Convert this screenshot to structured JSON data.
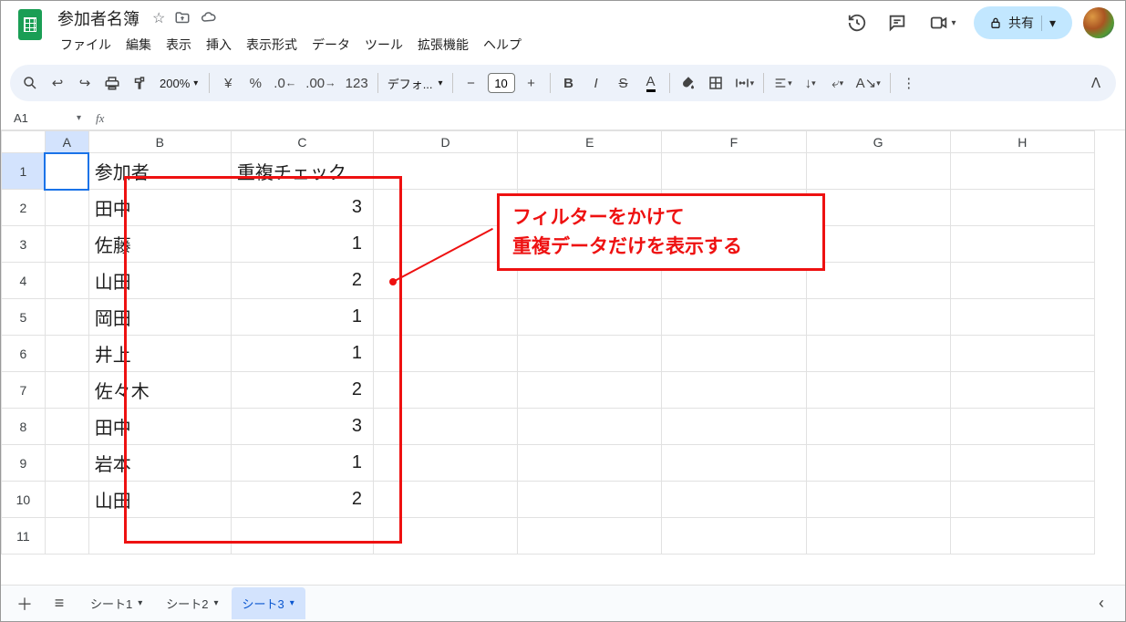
{
  "header": {
    "doc_title": "参加者名簿",
    "menus": [
      "ファイル",
      "編集",
      "表示",
      "挿入",
      "表示形式",
      "データ",
      "ツール",
      "拡張機能",
      "ヘルプ"
    ]
  },
  "share": {
    "label": "共有"
  },
  "toolbar": {
    "zoom": "200%",
    "font": "デフォ...",
    "font_size": "10"
  },
  "namebox": {
    "ref": "A1",
    "formula": ""
  },
  "columns": [
    "A",
    "B",
    "C",
    "D",
    "E",
    "F",
    "G",
    "H"
  ],
  "rows": [
    {
      "n": "1",
      "B": "参加者",
      "C": "重複チェック",
      "c_num": false
    },
    {
      "n": "2",
      "B": "田中",
      "C": "3"
    },
    {
      "n": "3",
      "B": "佐藤",
      "C": "1"
    },
    {
      "n": "4",
      "B": "山田",
      "C": "2"
    },
    {
      "n": "5",
      "B": "岡田",
      "C": "1"
    },
    {
      "n": "6",
      "B": "井上",
      "C": "1"
    },
    {
      "n": "7",
      "B": "佐々木",
      "C": "2"
    },
    {
      "n": "8",
      "B": "田中",
      "C": "3"
    },
    {
      "n": "9",
      "B": "岩本",
      "C": "1"
    },
    {
      "n": "10",
      "B": "山田",
      "C": "2"
    },
    {
      "n": "11",
      "B": "",
      "C": ""
    }
  ],
  "callout": {
    "line1": "フィルターをかけて",
    "line2": "重複データだけを表示する"
  },
  "sheets": {
    "tabs": [
      {
        "label": "シート1",
        "active": false
      },
      {
        "label": "シート2",
        "active": false
      },
      {
        "label": "シート3",
        "active": true
      }
    ]
  }
}
